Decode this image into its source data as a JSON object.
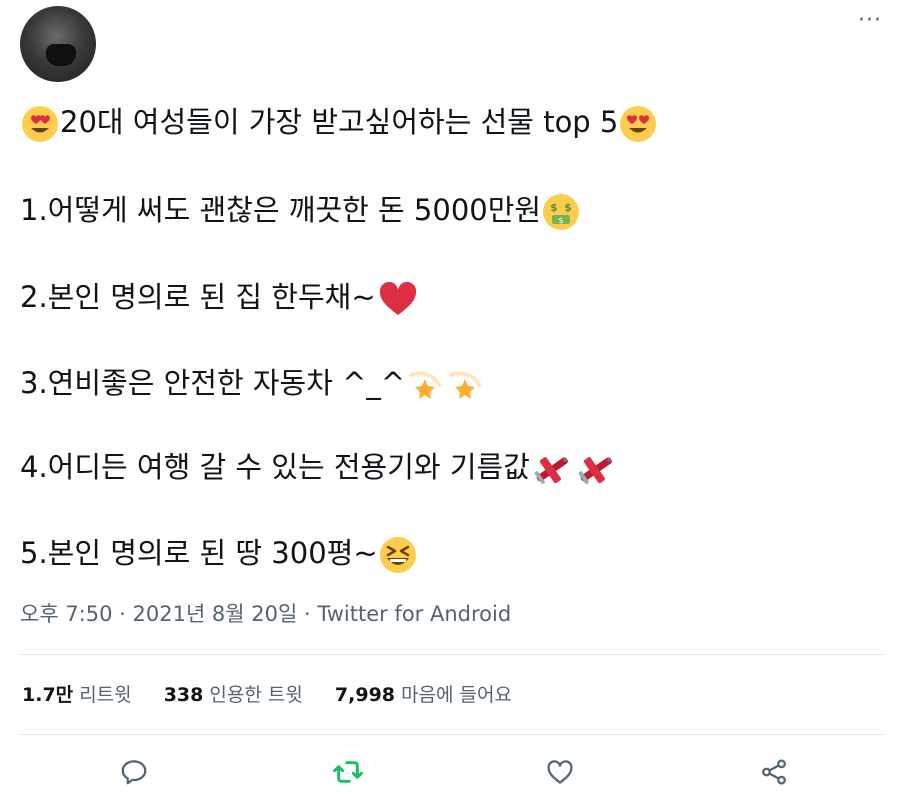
{
  "tweet": {
    "more_icon": "more-horizontal-icon",
    "title": "20대 여성들이 가장 받고싶어하는 선물 top 5",
    "items": [
      "1.어떻게 써도 괜찮은 깨끗한 돈 5000만원",
      "2.본인 명의로 된 집 한두채~",
      "3.연비좋은 안전한 자동차 ^_^",
      "4.어디든 여행 갈 수 있는 전용기와 기름값",
      "5.본인 명의로 된 땅 300평~"
    ],
    "timestamp": "오후 7:50 · 2021년 8월 20일 · ",
    "source": "Twitter for Android"
  },
  "stats": {
    "retweets_count": "1.7만",
    "retweets_label": "리트윗",
    "quotes_count": "338",
    "quotes_label": "인용한 트윗",
    "likes_count": "7,998",
    "likes_label": "마음에 들어요"
  },
  "actions": {
    "reply_icon": "reply-icon",
    "retweet_icon": "retweet-icon",
    "like_icon": "heart-icon",
    "share_icon": "share-icon",
    "retweet_color": "#17bf63",
    "icon_color": "#536471"
  }
}
